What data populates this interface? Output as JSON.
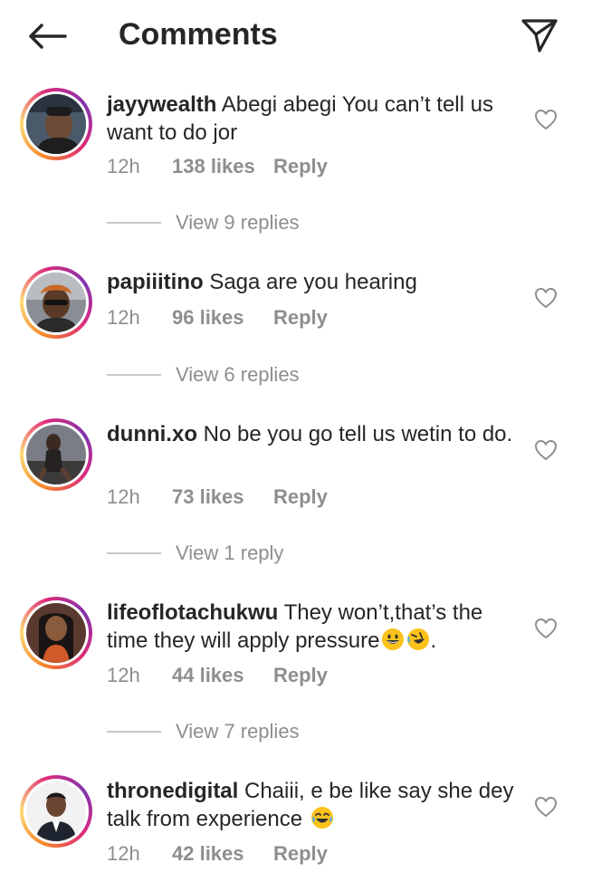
{
  "header": {
    "title": "Comments",
    "back_icon": "arrow-left-icon",
    "share_icon": "paper-plane-icon"
  },
  "comments": [
    {
      "username": "jayywealth",
      "text": "Abegi abegi You can’t tell us want to do jor",
      "time": "12h",
      "likes": "138 likes",
      "reply": "Reply",
      "view_replies": "View 9 replies"
    },
    {
      "username": "papiiitino",
      "text": "Saga are you hearing",
      "time": "12h",
      "likes": "96 likes",
      "reply": "Reply",
      "view_replies": "View 6 replies"
    },
    {
      "username": "dunni.xo",
      "text": "No be you go tell us wetin to do.",
      "time": "12h",
      "likes": "73 likes",
      "reply": "Reply",
      "view_replies": "View 1 reply"
    },
    {
      "username": "lifeoflotachukwu",
      "text": "They won’t,that’s the time they will apply pressure",
      "text_suffix": ".",
      "emojis": [
        "grinning-face-emoji",
        "rolling-on-floor-laughing-emoji"
      ],
      "time": "12h",
      "likes": "44 likes",
      "reply": "Reply",
      "view_replies": "View 7 replies"
    },
    {
      "username": "thronedigital",
      "text": "Chaiii, e be like say she dey talk from experience",
      "emojis": [
        "tears-of-joy-emoji"
      ],
      "time": "12h",
      "likes": "42 likes",
      "reply": "Reply"
    }
  ],
  "colors": {
    "text": "#262626",
    "secondary": "#8e8e8e",
    "story_ring": [
      "#f58529",
      "#dd2a7b",
      "#8134af"
    ]
  }
}
